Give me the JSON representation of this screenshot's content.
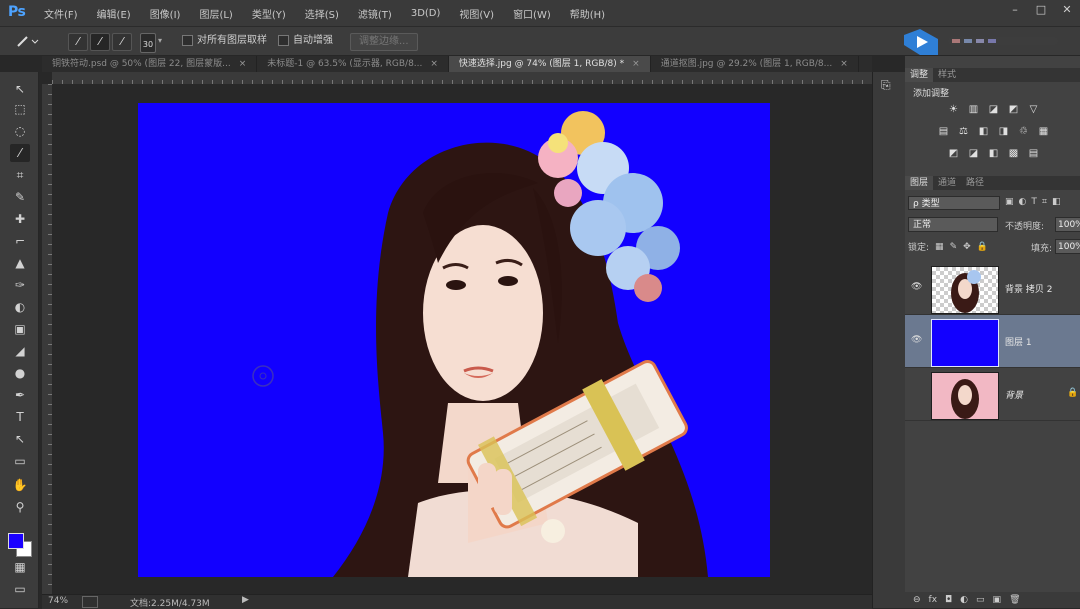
{
  "app": {
    "logo": "Ps"
  },
  "menu": [
    "文件(F)",
    "编辑(E)",
    "图像(I)",
    "图层(L)",
    "类型(Y)",
    "选择(S)",
    "滤镜(T)",
    "3D(D)",
    "视图(V)",
    "窗口(W)",
    "帮助(H)"
  ],
  "window_controls": [
    "–",
    "□",
    "✕"
  ],
  "options": {
    "brush_size": "30",
    "sample_all_layers": "对所有图层取样",
    "auto_enhance": "自动增强",
    "refine_edge": "调整边缘..."
  },
  "tabs": [
    {
      "label": "铜铁符动.psd @ 50% (图层 22, 图层蒙版...",
      "active": false
    },
    {
      "label": "未标题-1 @ 63.5% (显示器, RGB/8...",
      "active": false
    },
    {
      "label": "快速选择.jpg @ 74% (图层 1, RGB/8) *",
      "active": true
    },
    {
      "label": "通道抠图.jpg @ 29.2% (图层 1, RGB/8...",
      "active": false
    }
  ],
  "tools": [
    "↖",
    "⬚",
    "◌",
    "⁄",
    "⌗",
    "✎",
    "✚",
    "⌐",
    "▲",
    "✑",
    "◐",
    "▣",
    "◢",
    "●",
    "✒",
    "T",
    "↖",
    "▭",
    "✋",
    "⚲",
    "▦",
    "▭"
  ],
  "colors": {
    "foreground": "#1a00ff",
    "background": "#ffffff",
    "accent": "#4da3ff"
  },
  "status": {
    "zoom": "74%",
    "doc_info": "文档:2.25M/4.73M",
    "arrow": "▶"
  },
  "right_panel": {
    "top_tabs": [
      "调整",
      "样式"
    ],
    "adjust_title": "添加调整",
    "adjust_rows": [
      [
        "☀",
        "▥",
        "◪",
        "◩",
        "▽"
      ],
      [
        "▤",
        "⚖",
        "◧",
        "◨",
        "♲",
        "▦"
      ],
      [
        "◩",
        "◪",
        "◧",
        "▩",
        "▤"
      ]
    ],
    "layer_tabs": [
      "图层",
      "通道",
      "路径"
    ],
    "filter": "ρ 类型",
    "filter_icons": [
      "▣",
      "◐",
      "T",
      "⌗",
      "◧"
    ],
    "blend_mode": "正常",
    "opacity_label": "不透明度:",
    "opacity": "100%",
    "lock_label": "锁定:",
    "lock_icons": [
      "▦",
      "✎",
      "✥",
      "🔒"
    ],
    "fill_label": "填充:",
    "fill": "100%",
    "layers": [
      {
        "name": "背景 拷贝 2",
        "eye": "👁",
        "selected": false
      },
      {
        "name": "图层 1",
        "eye": "👁",
        "selected": true
      },
      {
        "name": "背景",
        "eye": "",
        "selected": false,
        "lock": "🔒"
      }
    ],
    "bottom_icons": [
      "⊖",
      "fx",
      "◘",
      "◐",
      "▭",
      "▣",
      "🗑"
    ]
  }
}
